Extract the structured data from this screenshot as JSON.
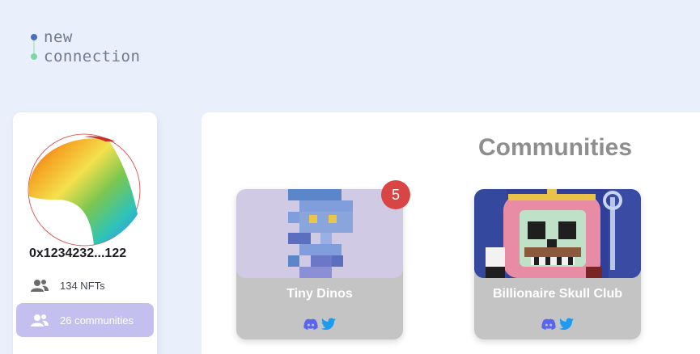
{
  "logo": {
    "line1": "new",
    "line2": "connection",
    "dot1_color": "#4a6fbf",
    "dot2_color": "#7ed6a6"
  },
  "profile": {
    "wallet_address": "0x1234232...122",
    "nft_count_label": "134 NFTs",
    "communities_label": "26 communities",
    "icons": {
      "nfts": "users-icon",
      "communities": "users-icon"
    },
    "active_color": "#c3c0ef"
  },
  "main": {
    "title": "Communities",
    "communities": [
      {
        "name": "Tiny Dinos",
        "notification_count": "5",
        "socials": [
          "discord-icon",
          "twitter-icon"
        ]
      },
      {
        "name": "Billionaire Skull Club",
        "socials": [
          "discord-icon",
          "twitter-icon"
        ]
      }
    ]
  },
  "colors": {
    "background": "#eaf0fb",
    "badge": "#d94545",
    "discord": "#5865f2",
    "twitter": "#1d9bf0"
  }
}
